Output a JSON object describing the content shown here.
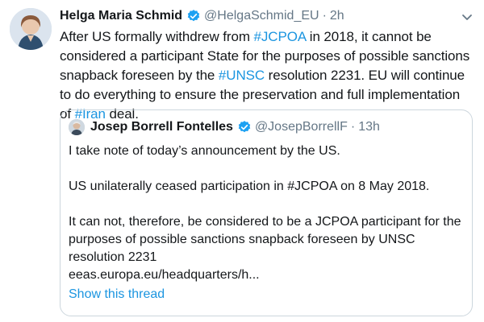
{
  "tweet": {
    "author_name": "Helga Maria Schmid",
    "handle": "@HelgaSchmid_EU",
    "separator": "·",
    "time": "2h",
    "text": {
      "p1": "After US formally withdrew from ",
      "tag1": "#JCPOA",
      "p2": " in 2018, it cannot be considered a participant State for the purposes of possible sanctions snapback foreseen by the ",
      "tag2": "#UNSC",
      "p3": " resolution 2231. EU will continue to do everything to ensure the preservation and full implementation of ",
      "tag3": "#Iran",
      "p4": " deal."
    }
  },
  "quoted": {
    "author_name": "Josep Borrell Fontelles",
    "handle": "@JosepBorrellF",
    "separator": "·",
    "time": "13h",
    "line1": "I take note of today’s announcement by the US.",
    "line2": "US unilaterally ceased participation in #JCPOA on 8 May 2018.",
    "line3": "It can not, therefore, be considered to be a JCPOA participant for the purposes of possible sanctions snapback foreseen by UNSC resolution 2231",
    "link": "eeas.europa.eu/headquarters/h...",
    "show_thread": "Show this thread"
  },
  "icons": {
    "verified": "verified-badge-icon",
    "caret": "chevron-down-icon"
  },
  "colors": {
    "link": "#1b95e0",
    "verified": "#1da1f2",
    "meta": "#657786",
    "border": "#ccd6dd"
  }
}
